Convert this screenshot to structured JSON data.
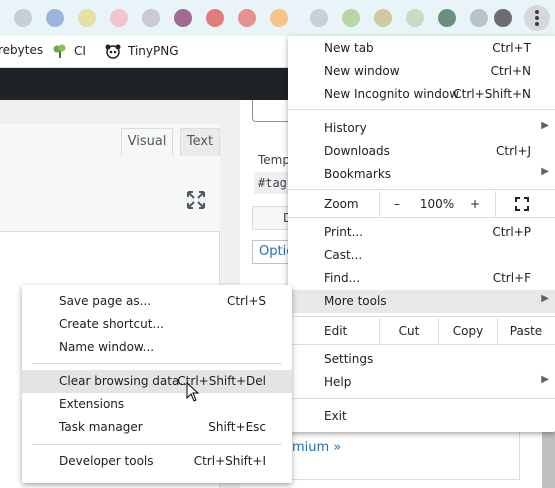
{
  "colors": {
    "admin_bar": "#1d2327",
    "link": "#2271b1",
    "menu_highlight": "#e8e8e9"
  },
  "bookmarks": [
    {
      "label": "rebytes",
      "icon": "bookmark-icon"
    },
    {
      "label": "CI",
      "icon": "ci-plant-icon"
    },
    {
      "label": "TinyPNG",
      "icon": "tinypng-panda-icon"
    }
  ],
  "editor": {
    "tab_visual": "Visual",
    "tab_text": "Text"
  },
  "sidebar": {
    "temp_label": "Temp",
    "tag_code": "#tag",
    "d_button": "D",
    "options_label": "Optio",
    "premium_link": "mium »"
  },
  "menu": {
    "new_tab": {
      "label": "New tab",
      "shortcut": "Ctrl+T"
    },
    "new_window": {
      "label": "New window",
      "shortcut": "Ctrl+N"
    },
    "new_incognito": {
      "label": "New Incognito window",
      "shortcut": "Ctrl+Shift+N"
    },
    "history": {
      "label": "History"
    },
    "downloads": {
      "label": "Downloads",
      "shortcut": "Ctrl+J"
    },
    "bookmarks": {
      "label": "Bookmarks"
    },
    "zoom": {
      "label": "Zoom",
      "minus": "–",
      "value": "100%",
      "plus": "+"
    },
    "print": {
      "label": "Print...",
      "shortcut": "Ctrl+P"
    },
    "cast": {
      "label": "Cast..."
    },
    "find": {
      "label": "Find...",
      "shortcut": "Ctrl+F"
    },
    "more_tools": {
      "label": "More tools"
    },
    "edit": {
      "label": "Edit",
      "cut": "Cut",
      "copy": "Copy",
      "paste": "Paste"
    },
    "settings": {
      "label": "Settings"
    },
    "help": {
      "label": "Help"
    },
    "exit": {
      "label": "Exit"
    }
  },
  "submenu": {
    "save_page": {
      "label": "Save page as...",
      "shortcut": "Ctrl+S"
    },
    "create_shortcut": {
      "label": "Create shortcut..."
    },
    "name_window": {
      "label": "Name window..."
    },
    "clear_browsing": {
      "label": "Clear browsing data...",
      "shortcut": "Ctrl+Shift+Del"
    },
    "extensions": {
      "label": "Extensions"
    },
    "task_manager": {
      "label": "Task manager",
      "shortcut": "Shift+Esc"
    },
    "developer_tools": {
      "label": "Developer tools",
      "shortcut": "Ctrl+Shift+I"
    }
  }
}
